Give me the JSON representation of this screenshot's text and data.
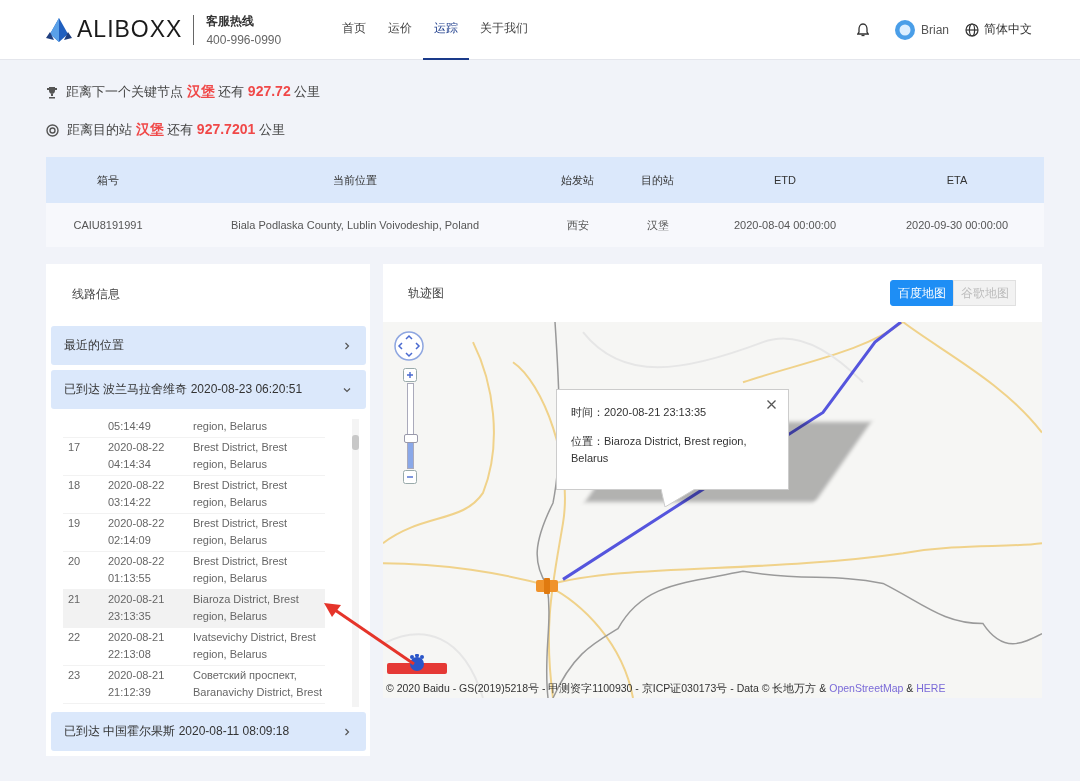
{
  "header": {
    "logo": "ALIBOXX",
    "hotline_label": "客服热线",
    "hotline": "400-996-0990",
    "nav": [
      {
        "label": "首页",
        "selected": false
      },
      {
        "label": "运价",
        "selected": false
      },
      {
        "label": "运踪",
        "selected": true
      },
      {
        "label": "关于我们",
        "selected": false
      }
    ],
    "user": "Brian",
    "language": "简体中文"
  },
  "distance_info": [
    {
      "kind": "next_node",
      "text": "距离下一个关键节点 **汉堡** 还有 **927.72** 公里"
    },
    {
      "kind": "destination",
      "text": "距离目的站 **汉堡** 还有 **927.7201** 公里"
    }
  ],
  "shipment_table": {
    "columns": [
      "箱号",
      "当前位置",
      "始发站",
      "目的站",
      "ETD",
      "ETA"
    ],
    "rows": [
      [
        "CAIU8191991",
        "Biala Podlaska County, Lublin Voivodeship, Poland",
        "西安",
        "汉堡",
        "2020-08-04 00:00:00",
        "2020-09-30 00:00:00"
      ]
    ]
  },
  "route_panel": {
    "title": "线路信息",
    "sections": [
      {
        "title": "最近的位置",
        "expanded": false
      },
      {
        "title": "已到达 波兰马拉舍维奇 2020-08-23 06:20:51",
        "expanded": true,
        "rows": [
          {
            "kind": "partial",
            "time": "05:14:49",
            "location": "region, Belarus",
            "selected": false
          },
          {
            "kind": "full",
            "no": "17",
            "date": "2020-08-22",
            "time": "04:14:34",
            "location": "Brest District, Brest\nregion, Belarus",
            "selected": false
          },
          {
            "kind": "full",
            "no": "18",
            "date": "2020-08-22",
            "time": "03:14:22",
            "location": "Brest District, Brest\nregion, Belarus",
            "selected": false
          },
          {
            "kind": "full",
            "no": "19",
            "date": "2020-08-22",
            "time": "02:14:09",
            "location": "Brest District, Brest\nregion, Belarus",
            "selected": false
          },
          {
            "kind": "full",
            "no": "20",
            "date": "2020-08-22",
            "time": "01:13:55",
            "location": "Brest District, Brest\nregion, Belarus",
            "selected": false
          },
          {
            "kind": "full",
            "no": "21",
            "date": "2020-08-21",
            "time": "23:13:35",
            "location": "Biaroza District, Brest\nregion, Belarus",
            "selected": true
          },
          {
            "kind": "full",
            "no": "22",
            "date": "2020-08-21",
            "time": "22:13:08",
            "location": "Ivatsevichy District, Brest\nregion, Belarus",
            "selected": false
          },
          {
            "kind": "full",
            "no": "23",
            "date": "2020-08-21",
            "time": "21:12:39",
            "location": "Советский проспект,\nBaranavichy District, Brest",
            "selected": false
          }
        ]
      },
      {
        "title": "已到达 中国霍尔果斯 2020-08-11 08:09:18",
        "expanded": false
      }
    ]
  },
  "map_panel": {
    "title": "轨迹图",
    "map_types": [
      {
        "label": "百度地图",
        "selected": true
      },
      {
        "label": "谷歌地图",
        "selected": false
      }
    ],
    "popup": {
      "time": "时间：2020-08-21 23:13:35",
      "location": "位置：Biaroza District, Brest region, Belarus"
    },
    "zoom": {
      "level": 0.3
    },
    "attribution": [
      {
        "text": "© 2020 Baidu - GS(2019)5218号 - 甲测资字1100930 - 京ICP证030173号 - Data © 长地万方 &",
        "kind": "text"
      },
      {
        "text": "OpenStreetMap",
        "kind": "link"
      },
      {
        "text": "&",
        "kind": "text"
      },
      {
        "text": "HERE",
        "kind": "link"
      }
    ]
  }
}
